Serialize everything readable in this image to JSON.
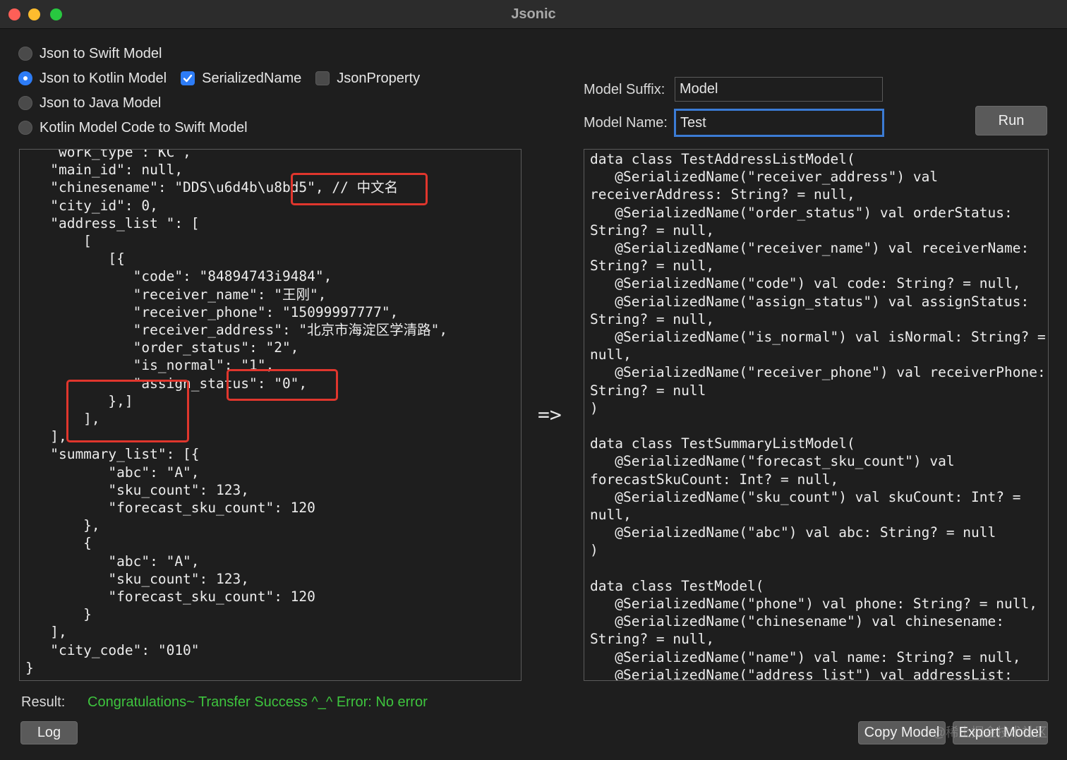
{
  "window": {
    "title": "Jsonic"
  },
  "modes": [
    {
      "label": "Json to Swift Model",
      "selected": false
    },
    {
      "label": "Json to Kotlin Model",
      "selected": true
    },
    {
      "label": "Json to Java Model",
      "selected": false
    },
    {
      "label": "Kotlin Model Code to Swift Model",
      "selected": false
    }
  ],
  "options": {
    "serialized_name": {
      "label": "SerializedName",
      "checked": true
    },
    "json_property": {
      "label": "JsonProperty",
      "checked": false
    }
  },
  "form": {
    "suffix_label": "Model Suffix:",
    "suffix_value": "Model",
    "name_label": "Model Name:",
    "name_value": "Test",
    "run_label": "Run"
  },
  "input_code": "    work_type : KC ,\n   \"main_id\": null,\n   \"chinesename\": \"DDS\\u6d4b\\u8bd5\", // 中文名\n   \"city_id\": 0,\n   \"address_list \": [\n       [\n          [{\n             \"code\": \"84894743i9484\",\n             \"receiver_name\": \"王刚\",\n             \"receiver_phone\": \"15099997777\",\n             \"receiver_address\": \"北京市海淀区学清路\",\n             \"order_status\": \"2\",\n             \"is_normal\": \"1\",\n             \"assign_status\": \"0\",\n          },]\n       ],\n   ],\n   \"summary_list\": [{\n          \"abc\": \"A\",\n          \"sku_count\": 123,\n          \"forecast_sku_count\": 120\n       },\n       {\n          \"abc\": \"A\",\n          \"sku_count\": 123,\n          \"forecast_sku_count\": 120\n       }\n   ],\n   \"city_code\": \"010\"\n}",
  "arrow": "=>",
  "output_code": "data class TestAddressListModel(\n   @SerializedName(\"receiver_address\") val\nreceiverAddress: String? = null,\n   @SerializedName(\"order_status\") val orderStatus:\nString? = null,\n   @SerializedName(\"receiver_name\") val receiverName:\nString? = null,\n   @SerializedName(\"code\") val code: String? = null,\n   @SerializedName(\"assign_status\") val assignStatus:\nString? = null,\n   @SerializedName(\"is_normal\") val isNormal: String? =\nnull,\n   @SerializedName(\"receiver_phone\") val receiverPhone:\nString? = null\n)\n\ndata class TestSummaryListModel(\n   @SerializedName(\"forecast_sku_count\") val\nforecastSkuCount: Int? = null,\n   @SerializedName(\"sku_count\") val skuCount: Int? =\nnull,\n   @SerializedName(\"abc\") val abc: String? = null\n)\n\ndata class TestModel(\n   @SerializedName(\"phone\") val phone: String? = null,\n   @SerializedName(\"chinesename\") val chinesename:\nString? = null,\n   @SerializedName(\"name\") val name: String? = null,\n   @SerializedName(\"address_list\") val addressList:",
  "result": {
    "label": "Result:",
    "text": "Congratulations~ Transfer Success ^_^  Error: No error",
    "color": "#3ec43e"
  },
  "buttons": {
    "log": "Log",
    "copy_model": "Copy Model",
    "export_model": "Export Model"
  },
  "watermark": "@稀土掘金技术社区",
  "colors": {
    "accent": "#2d7cf6",
    "highlight_box": "#e0362d",
    "background": "#1e1e1e"
  }
}
